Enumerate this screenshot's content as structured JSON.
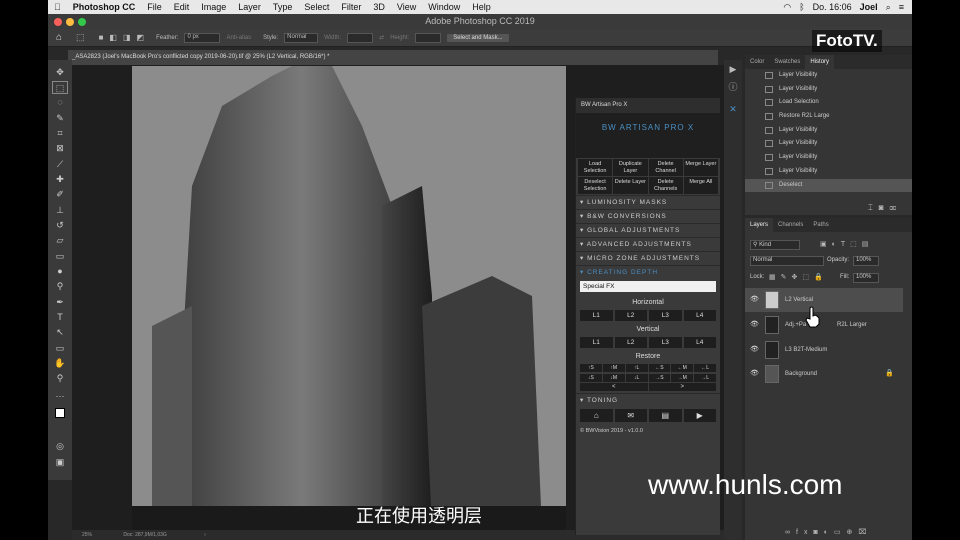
{
  "menubar": {
    "app": "Photoshop CC",
    "items": [
      "File",
      "Edit",
      "Image",
      "Layer",
      "Type",
      "Select",
      "Filter",
      "3D",
      "View",
      "Window",
      "Help"
    ],
    "clock": "Do. 16:06",
    "user": "Joel"
  },
  "window": {
    "title": "Adobe Photoshop CC 2019"
  },
  "options": {
    "feather_label": "Feather:",
    "feather_value": "0 px",
    "antialias": "Anti-alias",
    "style_label": "Style:",
    "style_value": "Normal",
    "width_label": "Width:",
    "height_label": "Height:",
    "select_mask": "Select and Mask..."
  },
  "doc": {
    "tab_title": "_ASA2823 (Joel's MacBook Pro's conflicted copy 2019-06-20).tif @ 25% (L2 Vertical, RGB/16*) *",
    "zoom": "25%",
    "docinfo": "Doc: 287,9M/1,03G"
  },
  "bwa": {
    "title": "BW Artisan Pro X",
    "logo": "BW ARTISAN PRO X",
    "btns": [
      "Load Selection",
      "Duplicate Layer",
      "Delete Channel",
      "Merge Layer",
      "Deselect Selection",
      "Delete Layer",
      "Delete Channels",
      "Merge All"
    ],
    "sections": [
      "LUMINOSITY MASKS",
      "B&W CONVERSIONS",
      "GLOBAL ADJUSTMENTS",
      "ADVANCED ADJUSTMENTS",
      "MICRO ZONE ADJUSTMENTS",
      "CREATING DEPTH"
    ],
    "select": "Special FX",
    "horizontal": "Horizontal",
    "vertical": "Vertical",
    "restore": "Restore",
    "lbtns": [
      "L1",
      "L2",
      "L3",
      "L4"
    ],
    "rbtns": [
      "↑S",
      "↑M",
      "↑L",
      "←S",
      "←M",
      "←L",
      "↓S",
      "↓M",
      "↓L",
      "→S",
      "→M",
      "→L"
    ],
    "arrows": [
      "<",
      ">"
    ],
    "toning": "TONING",
    "copyright": "© BWVision 2019 - v1.0.0"
  },
  "history": {
    "tabs": [
      "Color",
      "Swatches",
      "History"
    ],
    "items": [
      "Layer Visibility",
      "Layer Visibility",
      "Load Selection",
      "Restore R2L Large",
      "Layer Visibility",
      "Layer Visibility",
      "Layer Visibility",
      "Layer Visibility",
      "Deselect"
    ]
  },
  "layers": {
    "tabs": [
      "Layers",
      "Channels",
      "Paths"
    ],
    "kind": "Kind",
    "blend": "Normal",
    "opacity_label": "Opacity:",
    "opacity": "100%",
    "lock_label": "Lock:",
    "fill_label": "Fill:",
    "fill": "100%",
    "items": [
      "L2 Vertical",
      "Adj.+Pa",
      "R2L Larger",
      "L3 B2T-Medium",
      "Background"
    ]
  },
  "overlays": {
    "fototv": "FotoTV.",
    "watermark": "www.hunls.com",
    "subtitle": "正在使用透明层"
  }
}
